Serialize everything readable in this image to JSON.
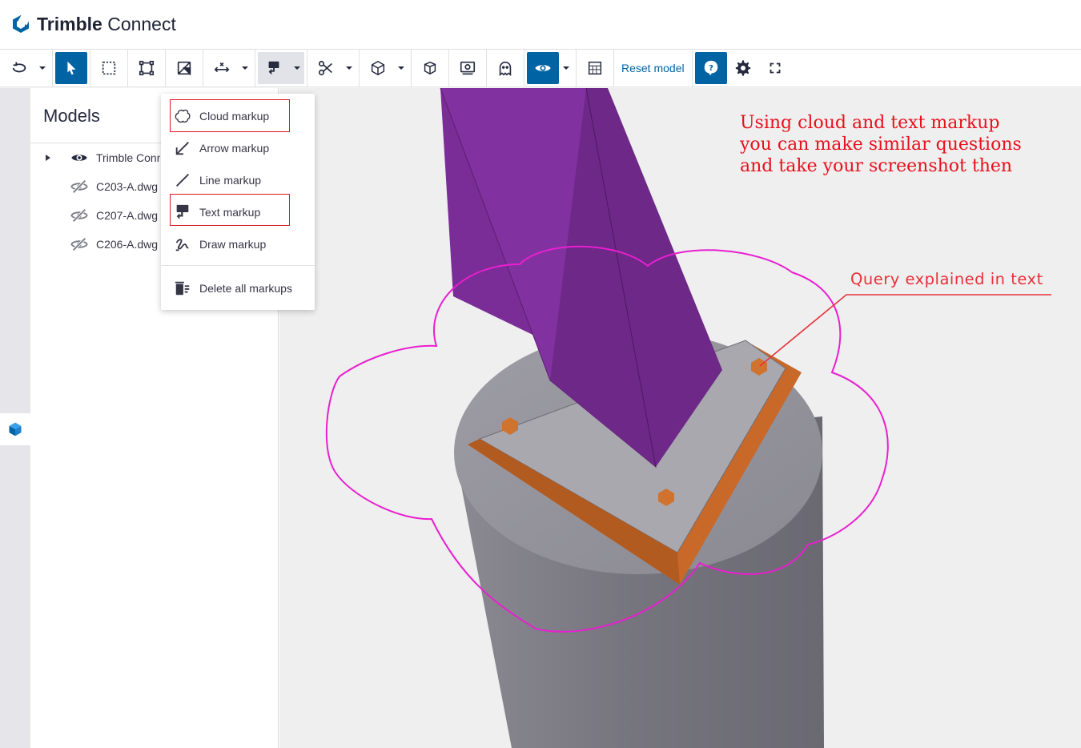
{
  "app": {
    "brand_bold": "Trimble",
    "brand_rest": " Connect"
  },
  "toolbar": {
    "reset_label": "Reset model",
    "icons": [
      "orbit-icon",
      "select-icon",
      "box-select-icon",
      "fit-icon",
      "clip-icon",
      "measure-icon",
      "markup-icon",
      "cut-icon",
      "view-cube-icon",
      "iso-view-icon",
      "snapshot-icon",
      "ghost-icon",
      "visibility-icon",
      "render-icon",
      "help-icon",
      "settings-icon",
      "fullscreen-icon"
    ],
    "accent": "#0063a3"
  },
  "models": {
    "title": "Models",
    "items": [
      {
        "label": "Trimble Connect",
        "visible": true
      },
      {
        "label": "C203-A.dwg",
        "visible": false
      },
      {
        "label": "C207-A.dwg",
        "visible": false
      },
      {
        "label": "C206-A.dwg",
        "visible": false
      }
    ]
  },
  "markup_menu": {
    "items": [
      {
        "label": "Cloud markup",
        "icon": "cloud-icon",
        "highlighted": true
      },
      {
        "label": "Arrow markup",
        "icon": "arrow-icon",
        "highlighted": false
      },
      {
        "label": "Line markup",
        "icon": "line-icon",
        "highlighted": false
      },
      {
        "label": "Text markup",
        "icon": "text-markup-icon",
        "highlighted": true
      },
      {
        "label": "Draw markup",
        "icon": "draw-icon",
        "highlighted": false
      }
    ],
    "delete_label": "Delete all markups"
  },
  "annotations": {
    "main_text": "Using cloud and text markup\nyou can make similar questions\nand take your screenshot then",
    "query_text": "Query explained in text",
    "annotation_color": "#e8101c",
    "cloud_color": "#e81fd0"
  },
  "scene_colors": {
    "column": "#7a2d96",
    "plate": "#c8692a",
    "concrete": "#8f8e96"
  }
}
